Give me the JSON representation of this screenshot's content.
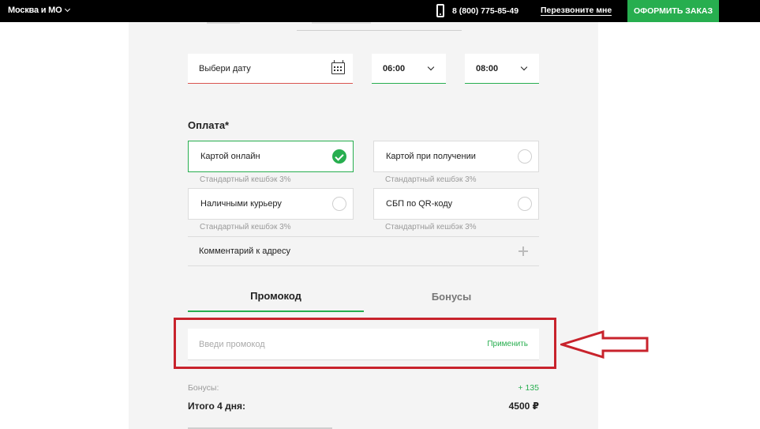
{
  "header": {
    "region": "Москва и МО",
    "phone": "8 (800) 775-85-49",
    "callback": "Перезвоните мне",
    "order_button": "ОФОРМИТЬ ЗАКАЗ"
  },
  "delivery": {
    "date_placeholder": "Выбери дату",
    "time_from": "06:00",
    "time_to": "08:00"
  },
  "payment": {
    "title": "Оплата*",
    "options": [
      {
        "label": "Картой онлайн",
        "cashback": "Стандартный кешбэк 3%",
        "selected": true
      },
      {
        "label": "Картой при получении",
        "cashback": "Стандартный кешбэк 3%",
        "selected": false
      },
      {
        "label": "Наличными курьеру",
        "cashback": "Стандартный кешбэк 3%",
        "selected": false
      },
      {
        "label": "СБП по QR-коду",
        "cashback": "Стандартный кешбэк 3%",
        "selected": false
      }
    ]
  },
  "comment": {
    "label": "Комментарий к адресу"
  },
  "tabs": [
    {
      "label": "Промокод",
      "active": true
    },
    {
      "label": "Бонусы",
      "active": false
    }
  ],
  "promo": {
    "placeholder": "Введи промокод",
    "value": "",
    "apply": "Применить"
  },
  "summary": {
    "bonus_label": "Бонусы:",
    "bonus_value": "+ 135",
    "total_label": "Итого 4 дня:",
    "total_value": "4500 ₽"
  },
  "colors": {
    "accent": "#27ae4f",
    "highlight": "#c8232c",
    "error_underline": "#d9534f"
  },
  "icons": [
    "chevron-down-icon",
    "phone-icon",
    "calendar-icon",
    "check-icon",
    "radio-icon",
    "plus-icon",
    "arrow-icon"
  ]
}
